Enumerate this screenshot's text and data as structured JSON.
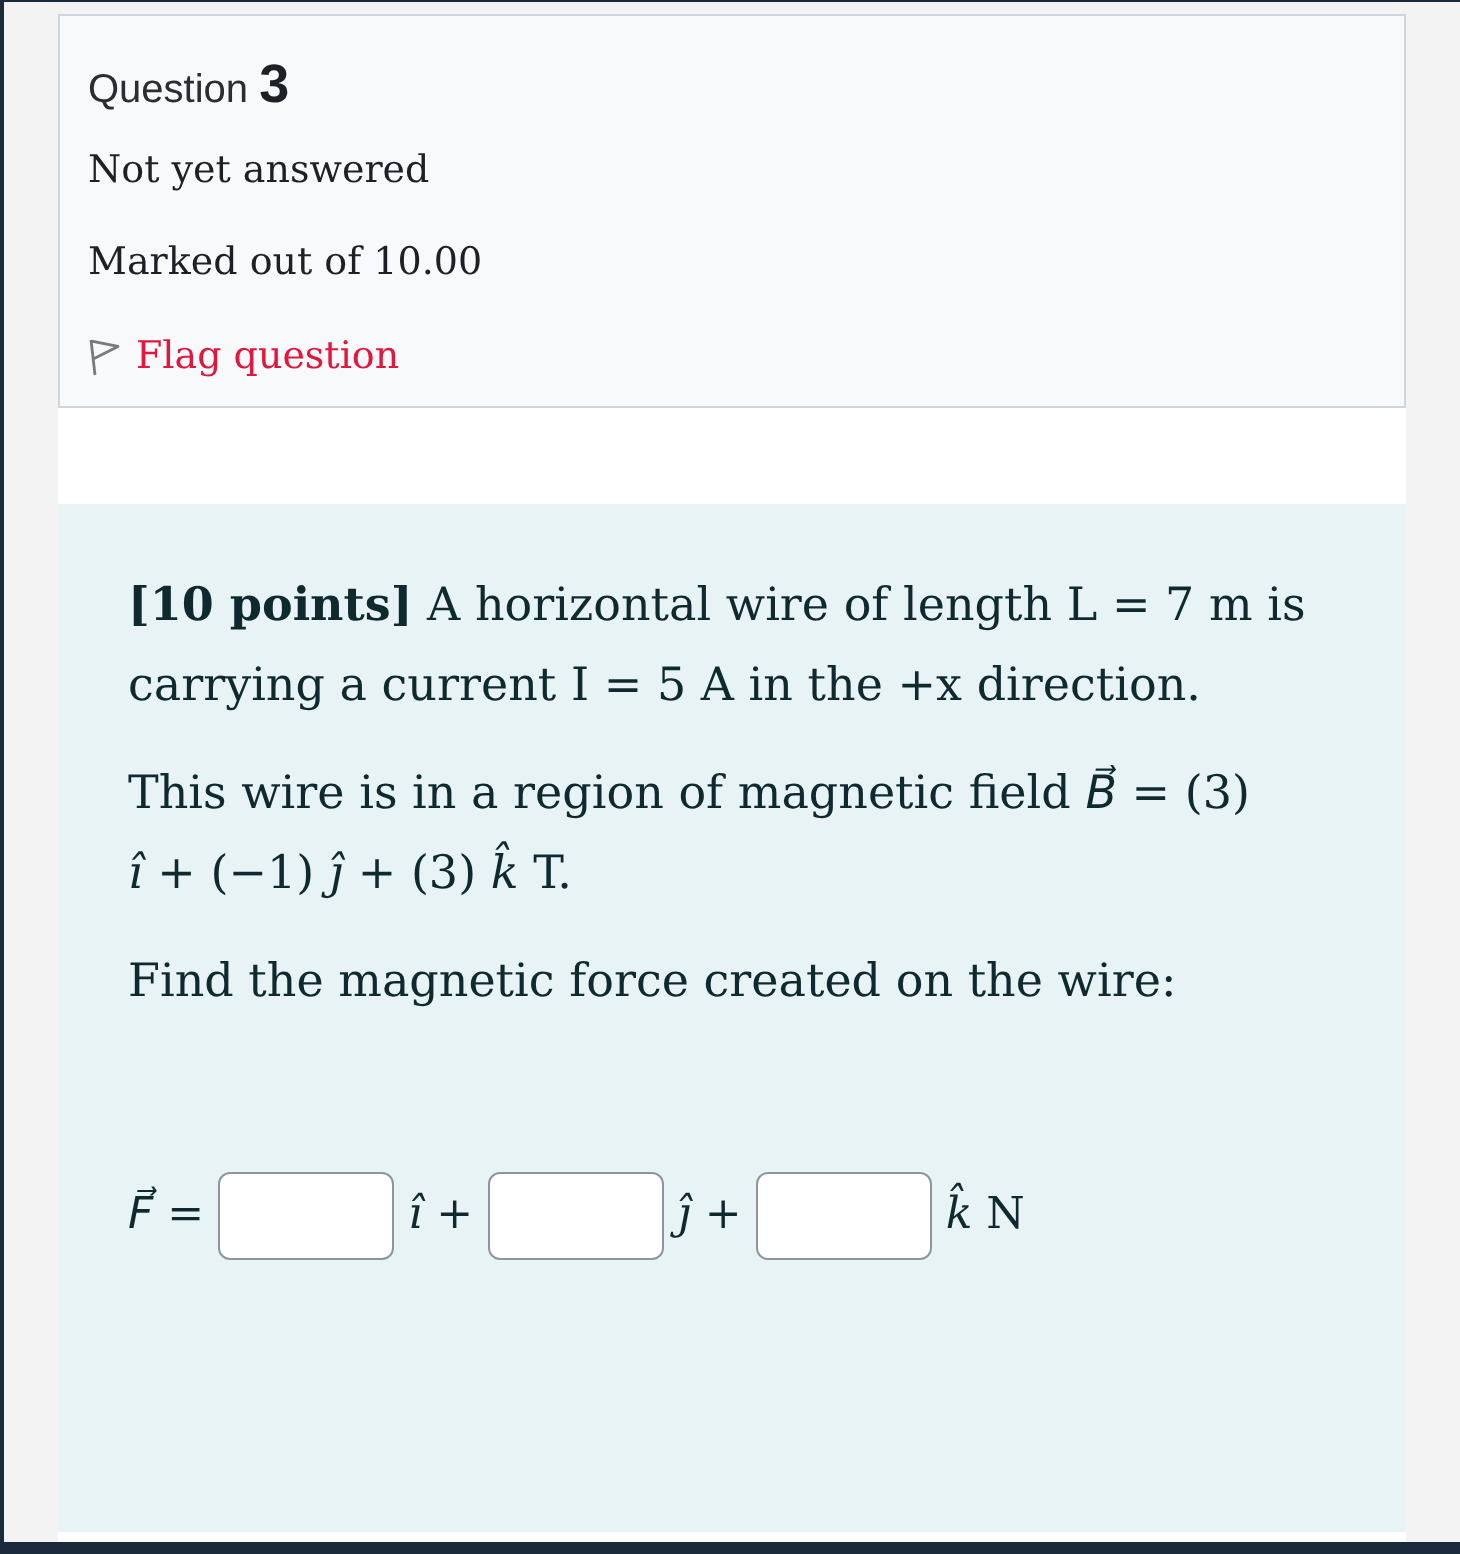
{
  "question_info": {
    "title": "Question **3**",
    "status": "Not yet answered",
    "grade": "Marked out of 10.00",
    "flag": {
      "label": "Flag question",
      "flagged": false
    }
  },
  "question": {
    "paragraphs": [
      "**[10 points]** A horizontal wire of length L = 7 m is carrying a current I = 5 A in the +x direction.",
      "This wire is in a region of magnetic field *B⃗* = (3) *ı̂* + (−1) *ȷ̂* + (3) *k̂* T.",
      "Find the magnetic force created on the wire:"
    ],
    "answer": {
      "lead": "*F⃗* =",
      "fields": [
        {
          "suffix": "*ı̂* +"
        },
        {
          "suffix": "*ȷ̂* +"
        },
        {
          "suffix": "*k̂* N"
        }
      ]
    }
  }
}
